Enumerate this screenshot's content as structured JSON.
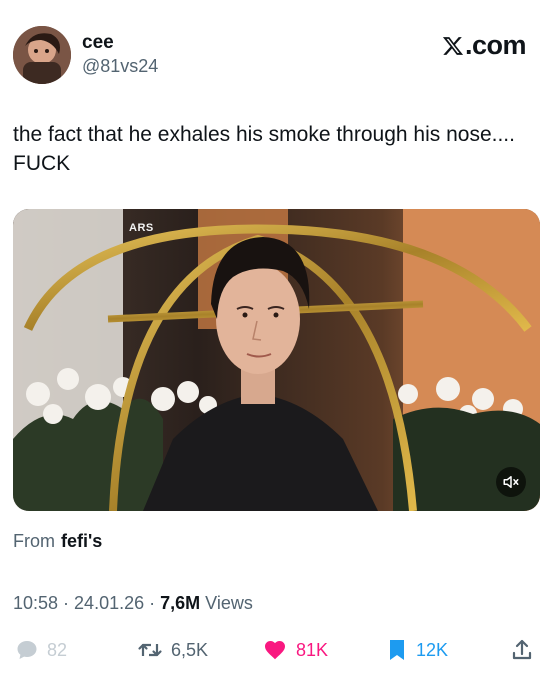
{
  "header": {
    "display_name": "cee",
    "handle": "@81vs24",
    "brand": ".com"
  },
  "tweet": {
    "text": "the fact that he exhales his smoke through his nose.... FUCK"
  },
  "media": {
    "watermark": "ARS",
    "mute_icon": "speaker-muted-icon"
  },
  "source": {
    "label": "From",
    "name": "fefi's"
  },
  "meta": {
    "time": "10:58",
    "separator": " · ",
    "date": "24.01.26",
    "views_count": "7,6M",
    "views_label": "Views"
  },
  "actions": {
    "reply_count": "82",
    "retweet_count": "6,5K",
    "like_count": "81K",
    "bookmark_count": "12K"
  },
  "colors": {
    "like": "#f91880",
    "bookmark": "#1d9bf0",
    "muted_text": "#536471",
    "text": "#0f1419"
  }
}
